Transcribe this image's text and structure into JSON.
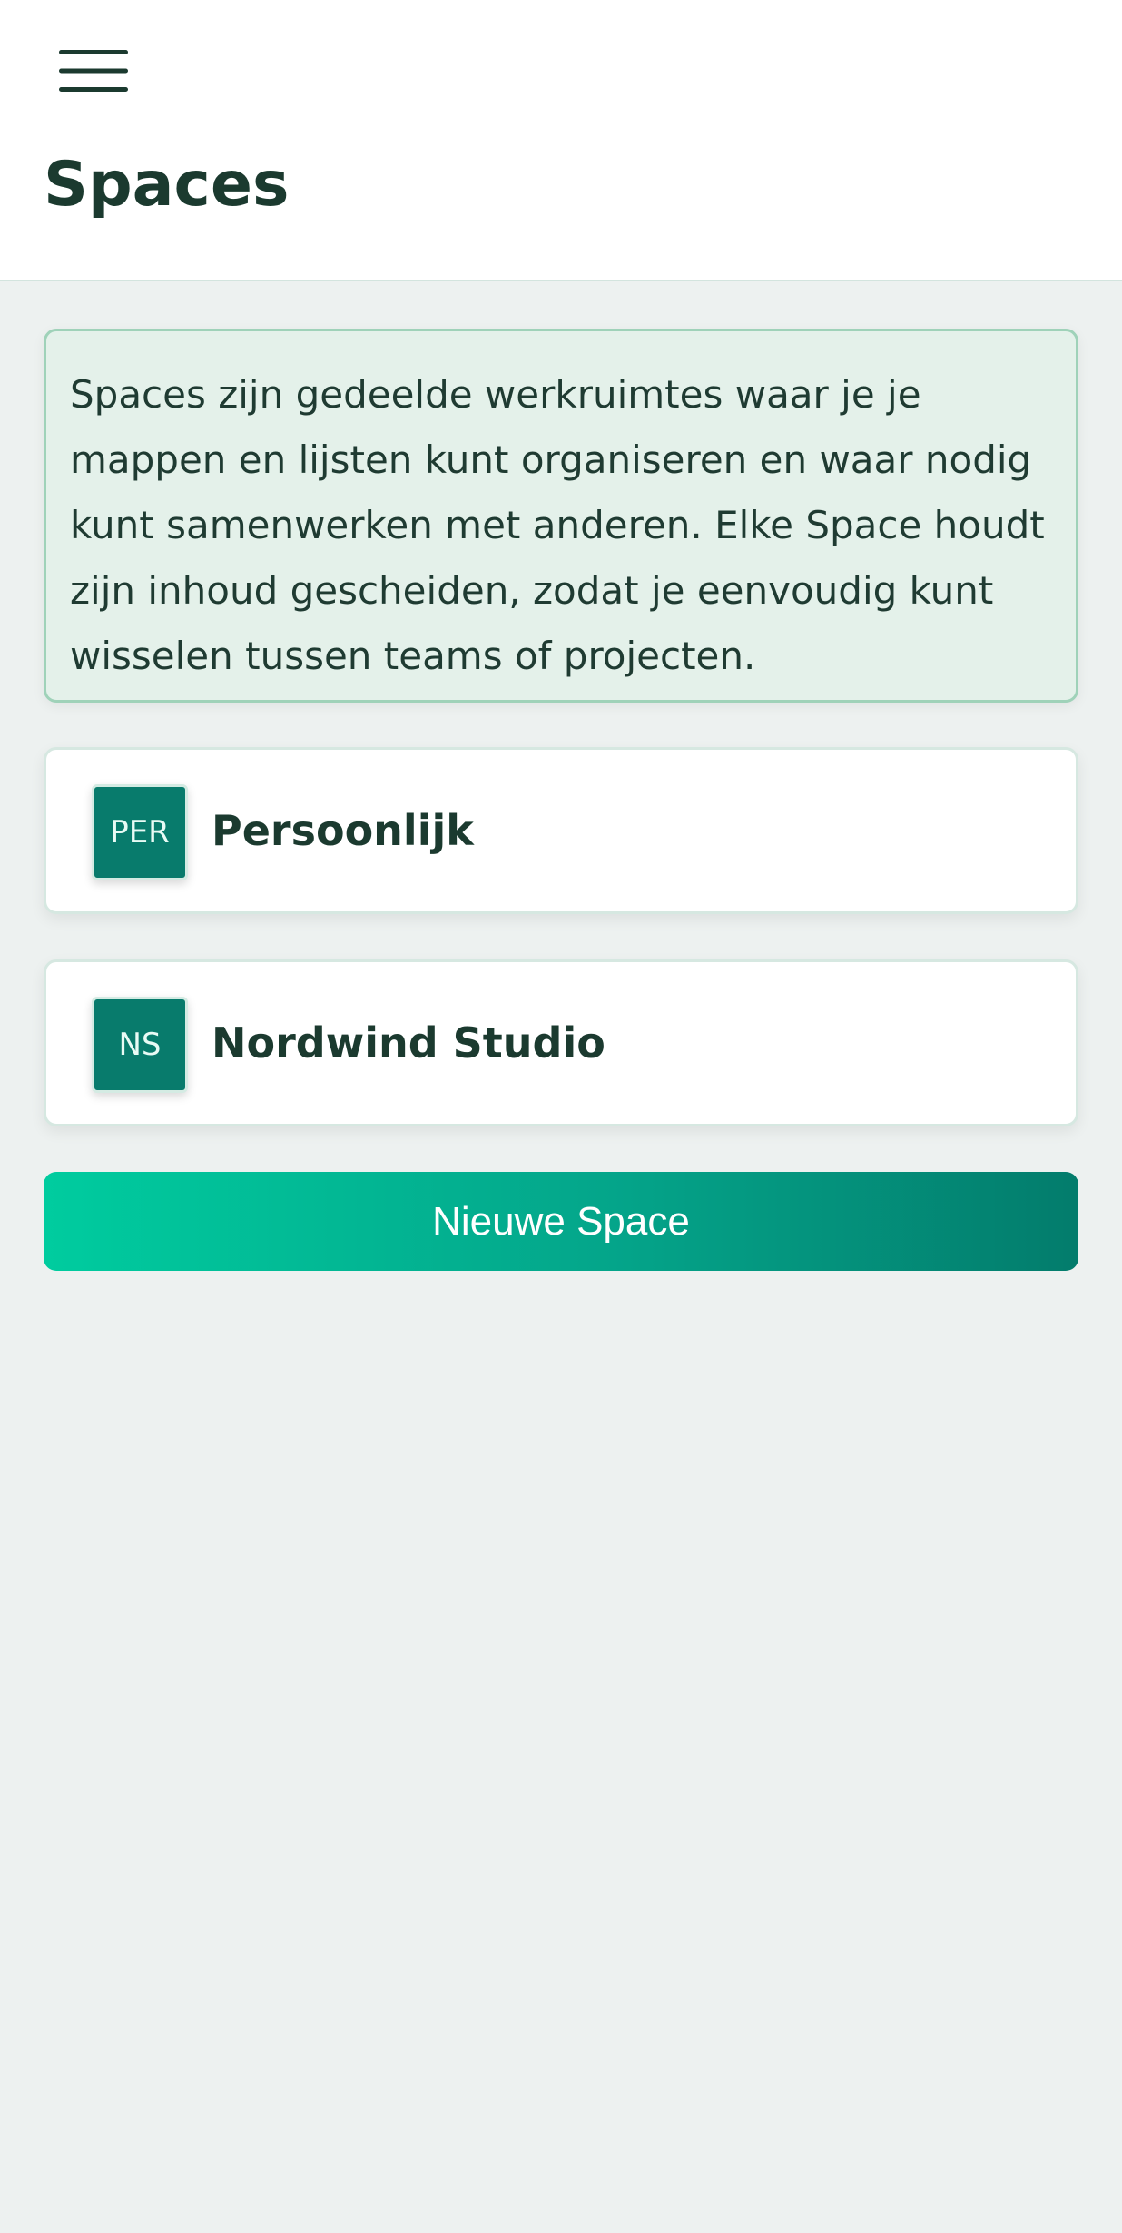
{
  "header": {
    "menu_icon": "hamburger-menu-icon",
    "title": "Spaces"
  },
  "info": {
    "text": "Spaces zijn gedeelde werkruimtes waar je je mappen en lijsten kunt organiseren en waar nodig kunt samenwerken met anderen. Elke Space houdt zijn inhoud gescheiden, zodat je eenvoudig kunt wisselen tussen teams of projecten."
  },
  "spaces": [
    {
      "initials": "PER",
      "name": "Persoonlijk"
    },
    {
      "initials": "NS",
      "name": "Nordwind Studio"
    }
  ],
  "actions": {
    "new_space_label": "Nieuwe Space"
  },
  "colors": {
    "title_text": "#1b3a2f",
    "avatar_bg": "#087b6c",
    "info_bg": "#e4f1ea",
    "info_border": "#9fd2b9",
    "button_gradient_start": "#00cc9f",
    "button_gradient_end": "#037c6c",
    "page_bg": "#edf1f0"
  }
}
